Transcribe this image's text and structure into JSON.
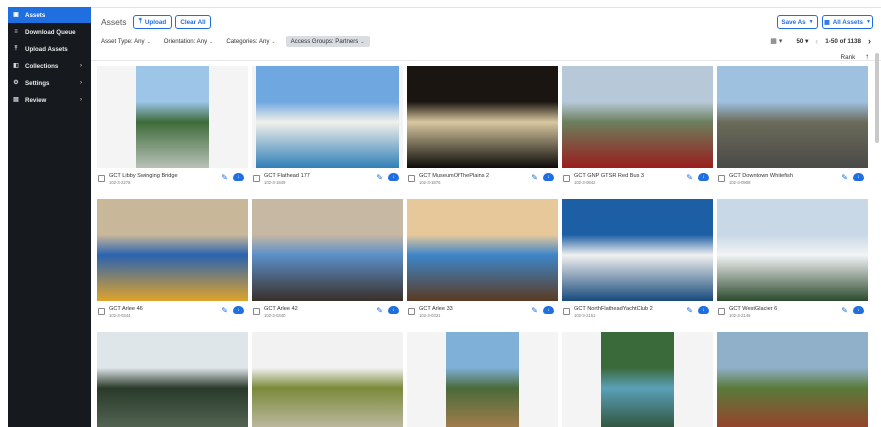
{
  "sidebar": {
    "items": [
      {
        "label": "Assets",
        "icon": "image-icon",
        "glyph": "▣",
        "active": true,
        "chevron": ""
      },
      {
        "label": "Download Queue",
        "icon": "queue-icon",
        "glyph": "≡",
        "active": false,
        "chevron": ""
      },
      {
        "label": "Upload Assets",
        "icon": "upload-icon",
        "glyph": "⤒",
        "active": false,
        "chevron": ""
      },
      {
        "label": "Collections",
        "icon": "collections-icon",
        "glyph": "◧",
        "active": false,
        "chevron": "›"
      },
      {
        "label": "Settings",
        "icon": "gear-icon",
        "glyph": "⚙",
        "active": false,
        "chevron": "›"
      },
      {
        "label": "Review",
        "icon": "review-icon",
        "glyph": "▤",
        "active": false,
        "chevron": "›"
      }
    ]
  },
  "header": {
    "title": "Assets",
    "upload_label": "Upload",
    "clear_label": "Clear All",
    "save_as_label": "Save As",
    "all_services_label": "All Assets"
  },
  "filters": [
    {
      "label": "Asset Type: Any",
      "active": false
    },
    {
      "label": "Orientation: Any",
      "active": false
    },
    {
      "label": "Categories: Any",
      "active": false
    },
    {
      "label": "Access Groups: Partners",
      "active": true
    }
  ],
  "pager": {
    "per_page": "50",
    "range": "1-50 of 1138"
  },
  "sort": {
    "label": "Rank"
  },
  "colors": {
    "accent": "#1f6fe0",
    "sidebar": "#161a1f"
  },
  "assets": [
    {
      "name": "GCT Libby Swinging Bridge",
      "id": "102-3-2278",
      "aspect": 0.72,
      "colors": [
        "#9cc5e8",
        "#3e6b3a",
        "#b9c2b8"
      ]
    },
    {
      "name": "GCT Flathead 177",
      "id": "102-3-1849",
      "aspect": 1.4,
      "colors": [
        "#6fa7e0",
        "#f2f0ea",
        "#2f7fb8"
      ]
    },
    {
      "name": "GCT MuseumOfThePlains 2",
      "id": "102-3-1876",
      "aspect": 1.5,
      "colors": [
        "#1a1510",
        "#d8c7a0",
        "#0c0b09"
      ]
    },
    {
      "name": "GCT GNP GTSR Red Bus 3",
      "id": "102-3-0842",
      "aspect": 1.5,
      "colors": [
        "#b7c9d8",
        "#6b7f5d",
        "#9a1d1d"
      ]
    },
    {
      "name": "GCT Downtown Whitefish",
      "id": "102-3-0908",
      "aspect": 1.5,
      "colors": [
        "#9ec1e0",
        "#6b6b5a",
        "#4a4a48"
      ]
    },
    {
      "name": "GCT Arlee 46",
      "id": "102-3-0344",
      "aspect": 1.5,
      "colors": [
        "#c9b79a",
        "#2b63b0",
        "#e0a32a"
      ]
    },
    {
      "name": "GCT Arlee 42",
      "id": "102-3-0340",
      "aspect": 1.5,
      "colors": [
        "#c7b8a4",
        "#5b8fc8",
        "#3a2f28"
      ]
    },
    {
      "name": "GCT Arlee 33",
      "id": "102-3-0331",
      "aspect": 1.5,
      "colors": [
        "#e7c89b",
        "#3d86c9",
        "#5a3a22"
      ]
    },
    {
      "name": "GCT NorthFlatheadYachtClub 2",
      "id": "102-3-2151",
      "aspect": 1.5,
      "colors": [
        "#1d5fa5",
        "#f0f0f0",
        "#174a7a"
      ]
    },
    {
      "name": "GCT WestGlacier 6",
      "id": "102-3-2145",
      "aspect": 1.5,
      "colors": [
        "#c9d8e6",
        "#f2f4f6",
        "#2d4a2d"
      ]
    },
    {
      "name": "",
      "id": "",
      "aspect": 1.5,
      "colors": [
        "#dfe6ea",
        "#2a3a2a",
        "#5a6b5a"
      ]
    },
    {
      "name": "",
      "id": "",
      "aspect": 1.5,
      "colors": [
        "#f2f2f2",
        "#7a8a3a",
        "#c7c0b0"
      ]
    },
    {
      "name": "",
      "id": "",
      "aspect": 0.72,
      "colors": [
        "#7fb0d8",
        "#4a6a3a",
        "#b08050"
      ]
    },
    {
      "name": "",
      "id": "",
      "aspect": 0.72,
      "colors": [
        "#3a6a3a",
        "#5aa0b8",
        "#2a4a2a"
      ]
    },
    {
      "name": "",
      "id": "",
      "aspect": 1.5,
      "colors": [
        "#8fb0c8",
        "#5a7a3a",
        "#a03a2a"
      ]
    }
  ]
}
